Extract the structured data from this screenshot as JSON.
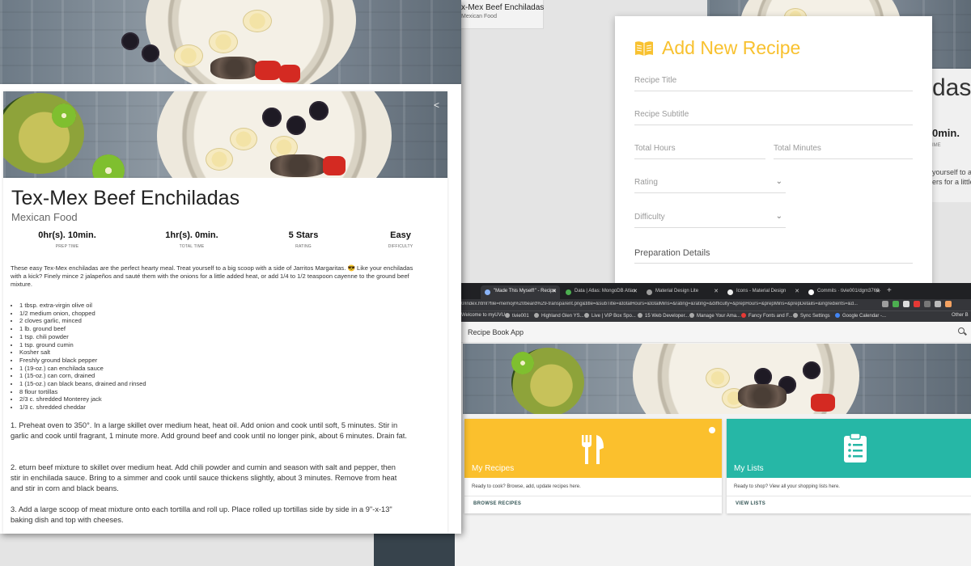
{
  "recipe": {
    "title": "Tex-Mex Beef Enchiladas",
    "subtitle": "Mexican Food",
    "stats": [
      {
        "value": "0hr(s). 10min.",
        "label": "PREP TIME"
      },
      {
        "value": "1hr(s). 0min.",
        "label": "TOTAL TIME"
      },
      {
        "value": "5 Stars",
        "label": "RATING"
      },
      {
        "value": "Easy",
        "label": "DIFFICULTY"
      }
    ],
    "intro": "These easy Tex-Mex enchiladas are the perfect hearty meal. Treat yourself to a big scoop with a side of Jarritos Margaritas. 😎 Like your enchiladas with a kick? Finely mince 2 jalapeños and sauté them with the onions for a little added heat, or add 1/4 to 1/2 teaspoon cayenne to the ground beef mixture.",
    "ingredients": [
      "1 tbsp. extra-virgin olive oil",
      "1/2 medium onion, chopped",
      "2 cloves garlic, minced",
      "1 lb. ground beef",
      "1 tsp. chili powder",
      "1 tsp. ground cumin",
      "Kosher salt",
      "Freshly ground black pepper",
      "1 (19-oz.) can enchilada sauce",
      "1 (15-oz.) can corn, drained",
      "1 (15-oz.) can black beans, drained and rinsed",
      "8 flour tortillas",
      "2/3 c. shredded Monterey jack",
      "1/3 c. shredded cheddar"
    ],
    "steps": [
      "1. Preheat oven to 350°. In a large skillet over medium heat, heat oil. Add onion and cook until soft, 5 minutes. Stir in garlic and cook until fragrant, 1 minute more. Add ground beef and cook until no longer pink, about 6 minutes. Drain fat.",
      "2. eturn beef mixture to skillet over medium heat. Add chili powder and cumin and season with salt and pepper, then stir in enchilada sauce. Bring to a simmer and cook until sauce thickens slightly, about 3 minutes. Remove from heat and stir in corn and black beans.",
      "3. Add a large scoop of meat mixture onto each tortilla and roll up. Place rolled up tortillas side by side in a 9\"-x-13\" baking dish and top with cheeses."
    ]
  },
  "top_strip": {
    "title": "x-Mex Beef Enchiladas",
    "subtitle": "Mexican Food"
  },
  "back_detail": {
    "title_fragment": "das",
    "time_fragment": "0min.",
    "label_fragment": "IME",
    "desc1": "yourself to a big",
    "desc2": "ers for a little ad"
  },
  "add_recipe": {
    "title": "Add New Recipe",
    "fields": {
      "recipe_title": "Recipe Title",
      "recipe_subtitle": "Recipe Subtitle",
      "total_hours": "Total Hours",
      "total_minutes": "Total Minutes",
      "rating": "Rating",
      "difficulty": "Difficulty",
      "preparation_details": "Preparation Details"
    },
    "accent": "#f8c12f"
  },
  "browser": {
    "tabs": [
      {
        "label": "\"Made This Myself!\" - Recipe"
      },
      {
        "label": "Data | Atlas: MongoDB Atlas"
      },
      {
        "label": "Material Design Lite"
      },
      {
        "label": "Icons - Material Design"
      },
      {
        "label": "Commits · tivie001/dgm3760-"
      }
    ],
    "url": "0/index.html?file=memoji%20beard%29-transparent.png&title=&subTitle=&totalHours=&totalMins=&rating=&rating=&difficulty=&prepHours=&prepMins=&prepDetails=&ingredients=&d...",
    "bookmarks": [
      "Welcome to myUVU",
      "tivie001",
      "Highland Glen YS...",
      "Live | VIP Box Spo...",
      "15 Web Developer...",
      "Manage Your Ama...",
      "Fancy Fonts and F...",
      "Sync Settings",
      "Google Calendar -...",
      "Other B"
    ],
    "app_title": "Recipe Book App",
    "tiles": [
      {
        "name": "My Recipes",
        "desc": "Ready to cook? Browse, add, update recipes here.",
        "button": "BROWSE RECIPES",
        "color": "#fbc02d",
        "icon": "restaurant-icon"
      },
      {
        "name": "My Lists",
        "desc": "Ready to shop? View all your shopping lists here.",
        "button": "VIEW LISTS",
        "color": "#26b7a6",
        "icon": "clipboard-list-icon"
      }
    ]
  }
}
